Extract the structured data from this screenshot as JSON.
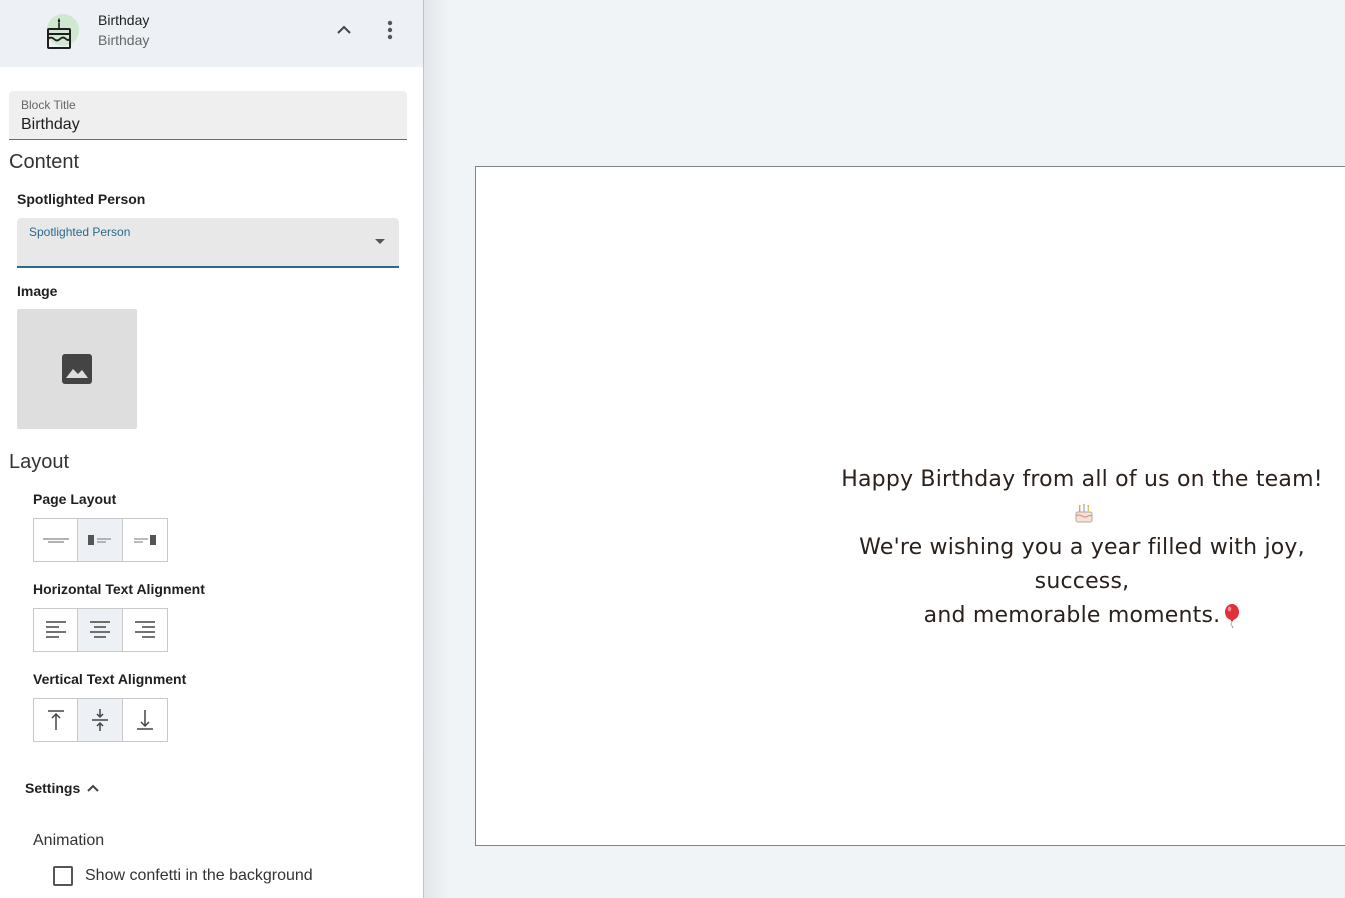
{
  "block": {
    "title": "Birthday",
    "subtitle": "Birthday"
  },
  "block_title_field": {
    "label": "Block Title",
    "value": "Birthday"
  },
  "content": {
    "heading": "Content",
    "spotlight_heading": "Spotlighted Person",
    "spotlight_select_label": "Spotlighted Person",
    "spotlight_select_value": "",
    "image_heading": "Image"
  },
  "layout": {
    "heading": "Layout",
    "page_layout": {
      "heading": "Page Layout",
      "options": [
        "text-only",
        "image-left",
        "image-right"
      ],
      "selected": "image-left"
    },
    "horizontal_alignment": {
      "heading": "Horizontal Text Alignment",
      "options": [
        "left",
        "center",
        "right"
      ],
      "selected": "center"
    },
    "vertical_alignment": {
      "heading": "Vertical Text Alignment",
      "options": [
        "top",
        "middle",
        "bottom"
      ],
      "selected": "middle"
    }
  },
  "settings": {
    "label": "Settings",
    "animation_heading": "Animation",
    "confetti_label": "Show confetti in the background",
    "confetti_checked": false
  },
  "preview": {
    "line1": "Happy Birthday from all of us on the team!",
    "line2": "We're wishing you a year filled with joy, success,",
    "line3": "and memorable moments.",
    "emoji1": "cake-icon",
    "emoji2": "balloon-icon"
  },
  "colors": {
    "accent": "#2a6a8c",
    "header_bg": "#edf1f5",
    "canvas_bg": "#f1f4f6",
    "preview_text": "#2b211c"
  }
}
